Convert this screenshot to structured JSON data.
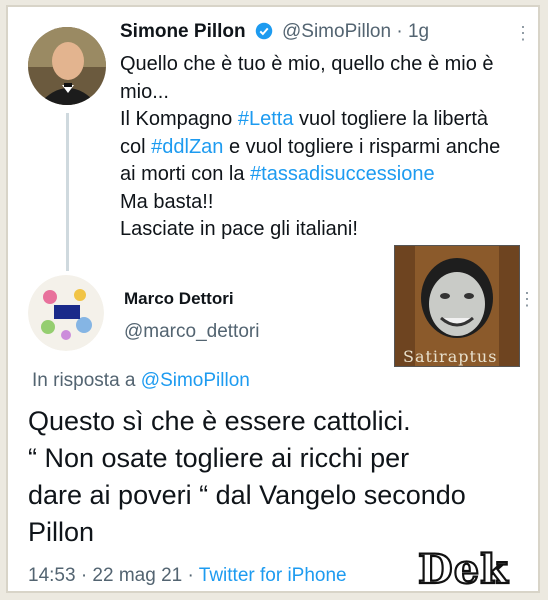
{
  "tweet": {
    "author_name": "Simone Pillon",
    "author_handle": "@SimoPillon",
    "time_ago": "1g",
    "lines": [
      "Quello che è tuo è mio, quello che è mio è",
      "mio...",
      "Il Kompagno ",
      "#Letta",
      " vuol togliere la libertà",
      "col ",
      "#ddlZan",
      " e vuol togliere i risparmi anche",
      "ai morti con la ",
      "#tassadisuccessione",
      "Ma basta!!",
      "Lasciate in pace gli italiani!"
    ]
  },
  "reply": {
    "author_name": "Marco Dettori",
    "author_handle": "@marco_dettori",
    "media_caption": "Satiraptus",
    "in_reply_prefix": "In risposta a ",
    "in_reply_mention": "@SimoPillon",
    "lines": [
      "Questo sì che è essere cattolici.",
      "“ Non osate togliere ai ricchi per",
      "dare ai poveri “ dal Vangelo secondo",
      "Pillon"
    ],
    "timestamp": "14:53 · 22 mag 21 · ",
    "source": "Twitter for iPhone"
  },
  "watermark": {
    "label": "Dek"
  },
  "more_icon": "⋮",
  "colors": {
    "link": "#1d9bf0",
    "secondary": "#536471",
    "text": "#0f1419"
  }
}
